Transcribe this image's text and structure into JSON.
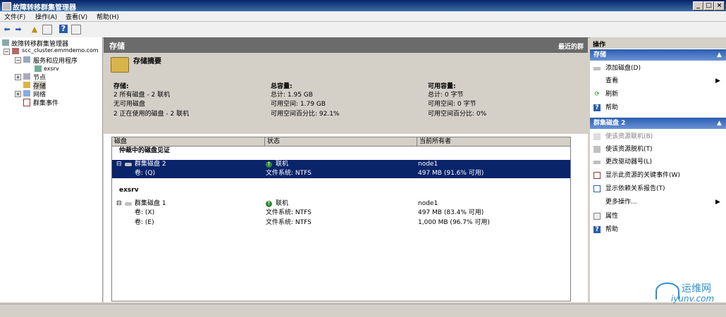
{
  "window": {
    "title": "故障转移群集管理器"
  },
  "menu": [
    {
      "label": "文件(F)"
    },
    {
      "label": "操作(A)"
    },
    {
      "label": "查看(V)"
    },
    {
      "label": "帮助(H)"
    }
  ],
  "toolbar_icons": [
    "back-arrow-icon",
    "forward-arrow-icon",
    "folder-up-icon",
    "show-hide-tree-icon",
    "help-icon",
    "properties-icon"
  ],
  "tree": {
    "root": "故障转移群集管理器",
    "cluster": "scc_cluster.emmdemo.com",
    "services": "服务和应用程序",
    "exsrv": "exsrv",
    "nodes": "节点",
    "storage": "存储",
    "networks": "网络",
    "events": "群集事件"
  },
  "center": {
    "header_title": "存储",
    "header_right": "最近的群",
    "summary_title": "存储摘要",
    "col1_title": "存储:",
    "col1_lines": [
      "2 所有磁盘 - 2 联机",
      "无可用磁盘",
      "2 正在使用的磁盘 - 2 联机"
    ],
    "col2_title": "总容量:",
    "col2_lines": [
      "总计: 1.95 GB",
      "可用空间: 1.79 GB",
      "可用空间百分比: 92.1%"
    ],
    "col3_title": "可用容量:",
    "col3_lines": [
      "总计: 0 字节",
      "可用空间: 0 字节",
      "可用空间百分比: 0%"
    ]
  },
  "grid": {
    "headers": [
      "磁盘",
      "状态",
      "当前所有者"
    ],
    "group1": "仲裁中的磁盘见证",
    "disk2": {
      "name": "群集磁盘 2",
      "status": "联机",
      "owner": "node1"
    },
    "disk2_vol": {
      "name": "卷: (Q)",
      "fs": "文件系统: NTFS",
      "size": "497 MB (91.6% 可用)"
    },
    "group2": "exsrv",
    "disk1": {
      "name": "群集磁盘 1",
      "status": "联机",
      "owner": "node1"
    },
    "disk1_vol1": {
      "name": "卷: (X)",
      "fs": "文件系统: NTFS",
      "size": "497 MB (83.4% 可用)"
    },
    "disk1_vol2": {
      "name": "卷: (E)",
      "fs": "文件系统: NTFS",
      "size": "1,000 MB (96.7% 可用)"
    }
  },
  "actions": {
    "title": "操作",
    "section1": "存储",
    "s1_items": [
      "添加磁盘(D)",
      "查看",
      "刷新",
      "帮助"
    ],
    "section2": "群集磁盘 2",
    "s2_items": [
      "使该资源联机(B)",
      "使该资源脱机(T)",
      "更改驱动器号(L)",
      "显示此资源的关键事件(W)",
      "显示依赖关系报告(T)",
      "更多操作...",
      "属性",
      "帮助"
    ]
  },
  "watermark": {
    "text1": "运维网",
    "text2": "iyunv.com"
  },
  "colors": {
    "selection": "#0a246a",
    "action_header": "#2a5db0",
    "online": "#2e8b2e"
  }
}
